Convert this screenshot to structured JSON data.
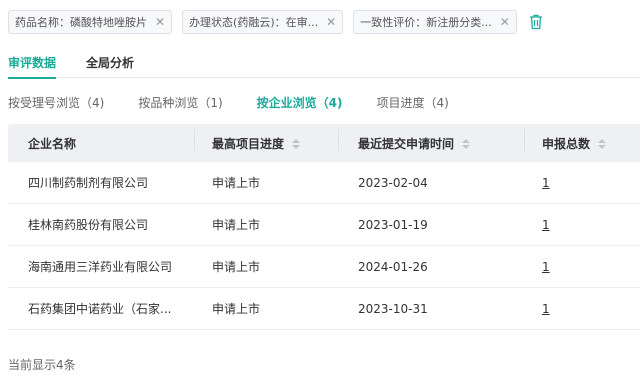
{
  "filters": [
    {
      "label": "药品名称：磷酸特地唑胺片"
    },
    {
      "label": "办理状态(药融云)：在审..."
    },
    {
      "label": "一致性评价：新注册分类..."
    }
  ],
  "filter_close_glyph": "✕",
  "trash_icon": "trash-icon",
  "accent_color": "#1aab9b",
  "main_tabs": [
    {
      "label": "审评数据",
      "active": true
    },
    {
      "label": "全局分析",
      "active": false
    }
  ],
  "sub_tabs": [
    {
      "label": "按受理号浏览（4)",
      "active": false
    },
    {
      "label": "按品种浏览（1)",
      "active": false
    },
    {
      "label": "按企业浏览（4)",
      "active": true
    },
    {
      "label": "项目进度（4)",
      "active": false
    }
  ],
  "table": {
    "headers": [
      "企业名称",
      "最高项目进度",
      "最近提交申请时间",
      "申报总数"
    ],
    "rows": [
      [
        "四川制药制剂有限公司",
        "申请上市",
        "2023-02-04",
        "1"
      ],
      [
        "桂林南药股份有限公司",
        "申请上市",
        "2023-01-19",
        "1"
      ],
      [
        "海南通用三洋药业有限公司",
        "申请上市",
        "2024-01-26",
        "1"
      ],
      [
        "石药集团中诺药业（石家...",
        "申请上市",
        "2023-10-31",
        "1"
      ]
    ]
  },
  "footer": {
    "text": "当前显示4条"
  }
}
